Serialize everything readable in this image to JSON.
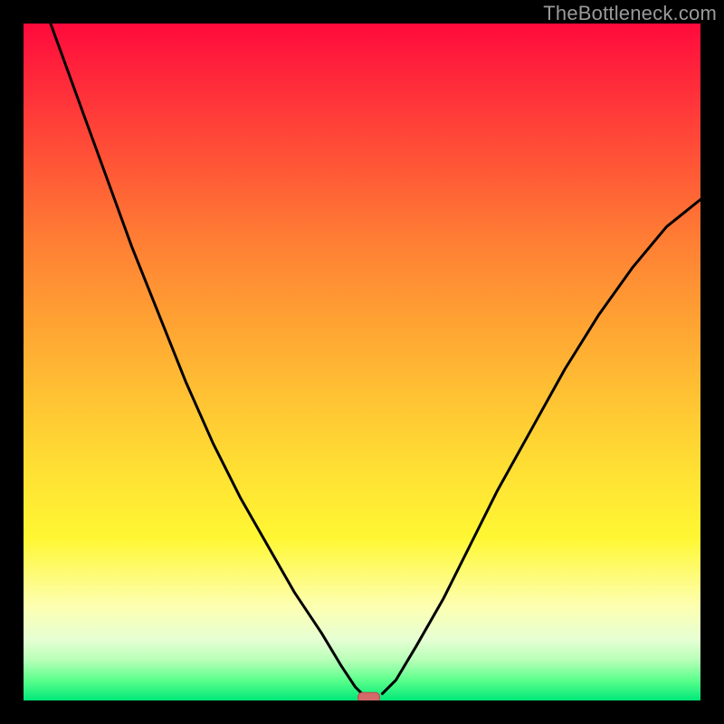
{
  "watermark": {
    "text": "TheBottleneck.com"
  },
  "chart_data": {
    "type": "line",
    "title": "",
    "xlabel": "",
    "ylabel": "",
    "xlim": [
      0,
      100
    ],
    "ylim": [
      0,
      100
    ],
    "grid": false,
    "legend": false,
    "background_gradient": {
      "orientation": "vertical",
      "stops": [
        {
          "pos": 0.0,
          "color": "#ff0a3c"
        },
        {
          "pos": 0.25,
          "color": "#ff6a35"
        },
        {
          "pos": 0.5,
          "color": "#ffbf33"
        },
        {
          "pos": 0.75,
          "color": "#fff733"
        },
        {
          "pos": 0.9,
          "color": "#f4ffc8"
        },
        {
          "pos": 1.0,
          "color": "#00e878"
        }
      ]
    },
    "series": [
      {
        "name": "left-branch",
        "x": [
          4,
          8,
          12,
          16,
          20,
          24,
          28,
          32,
          36,
          40,
          44,
          47,
          49,
          50
        ],
        "y": [
          100,
          89,
          78,
          67,
          57,
          47,
          38,
          30,
          23,
          16,
          10,
          5,
          2,
          1
        ]
      },
      {
        "name": "right-branch",
        "x": [
          53,
          55,
          58,
          62,
          66,
          70,
          75,
          80,
          85,
          90,
          95,
          100
        ],
        "y": [
          1,
          3,
          8,
          15,
          23,
          31,
          40,
          49,
          57,
          64,
          70,
          74
        ]
      }
    ],
    "minimum_marker": {
      "x": 51,
      "y": 0.5,
      "color": "#d46a6a"
    }
  }
}
